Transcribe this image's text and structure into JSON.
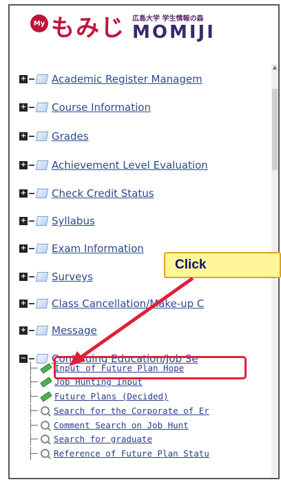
{
  "header": {
    "my_badge": "My",
    "logo_jp": "もみじ",
    "logo_sub": "広島大学 学生情報の森",
    "logo_en": "MOMIJI"
  },
  "tree": {
    "items": [
      {
        "label": "Academic Register Managem"
      },
      {
        "label": "Course Information"
      },
      {
        "label": "Grades"
      },
      {
        "label": "Achievement Level Evaluation"
      },
      {
        "label": "Check Credit Status"
      },
      {
        "label": "Syllabus"
      },
      {
        "label": "Exam Information"
      },
      {
        "label": "Surveys"
      },
      {
        "label": "Class Cancellation/Make-up C"
      },
      {
        "label": "Message"
      },
      {
        "label": "Continuing Education/Job Se"
      }
    ],
    "subitems": [
      {
        "label": "Input of Future Plan Hope",
        "icon": "pencil-icon"
      },
      {
        "label": "Job Hunting Input",
        "icon": "pencil-icon"
      },
      {
        "label": "Future Plans (Decided)",
        "icon": "pencil-icon"
      },
      {
        "label": "Search for the Corporate of Er",
        "icon": "magnifier-icon"
      },
      {
        "label": "Comment Search on Job Hunt",
        "icon": "magnifier-icon"
      },
      {
        "label": "Search for graduate",
        "icon": "magnifier-icon"
      },
      {
        "label": "Reference of Future Plan Statu",
        "icon": "magnifier-icon"
      }
    ]
  },
  "callout": {
    "text": "Click"
  },
  "colors": {
    "brand": "#c0143c",
    "link": "#2a4a8a",
    "highlight": "#e0203a",
    "callout_bg": "#fff59a"
  }
}
